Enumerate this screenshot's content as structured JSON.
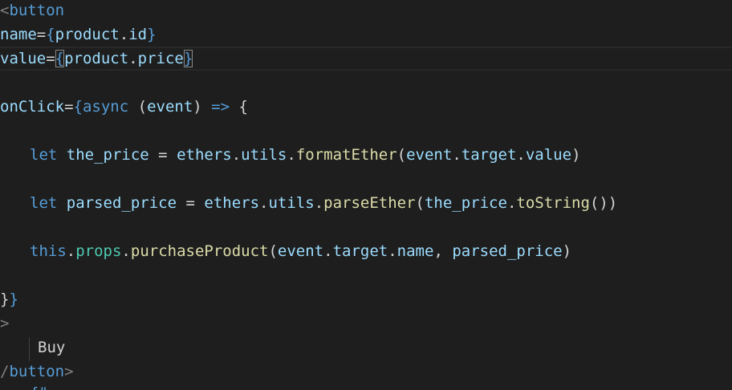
{
  "code": {
    "l1_open": "<",
    "l1_tag": "button",
    "l2_attr": "name",
    "l2_eq": "=",
    "l2_open": "{",
    "l2_obj": "product",
    "l2_dot": ".",
    "l2_prop": "id",
    "l2_close": "}",
    "l3_attr": "value",
    "l3_eq": "=",
    "l3_open": "{",
    "l3_obj": "product",
    "l3_dot": ".",
    "l3_prop": "price",
    "l3_close": "}",
    "l5_attr": "onClick",
    "l5_eq": "=",
    "l5_open": "{",
    "l5_async": "async",
    "l5_paren_open": " (",
    "l5_param": "event",
    "l5_paren_close": ") ",
    "l5_arrow": "=>",
    "l5_brace": " {",
    "l7_let": "let",
    "l7_var": "the_price",
    "l7_eq": " = ",
    "l7_obj": "ethers",
    "l7_dot1": ".",
    "l7_utils": "utils",
    "l7_dot2": ".",
    "l7_fn": "formatEther",
    "l7_p1": "(",
    "l7_event": "event",
    "l7_dot3": ".",
    "l7_target": "target",
    "l7_dot4": ".",
    "l7_value": "value",
    "l7_p2": ")",
    "l9_let": "let",
    "l9_var": "parsed_price",
    "l9_eq": " = ",
    "l9_obj": "ethers",
    "l9_dot1": ".",
    "l9_utils": "utils",
    "l9_dot2": ".",
    "l9_fn": "parseEther",
    "l9_p1": "(",
    "l9_arg": "the_price",
    "l9_dot3": ".",
    "l9_fn2": "toString",
    "l9_p2": "())",
    "l11_this": "this",
    "l11_dot1": ".",
    "l11_props": "props",
    "l11_dot2": ".",
    "l11_fn": "purchaseProduct",
    "l11_p1": "(",
    "l11_event": "event",
    "l11_dot3": ".",
    "l11_target": "target",
    "l11_dot4": ".",
    "l11_name": "name",
    "l11_comma": ", ",
    "l11_arg": "parsed_price",
    "l11_p2": ")",
    "l13_brace1": "}",
    "l13_brace2": "}",
    "l14_gt": ">",
    "l15_text": "Buy",
    "l16_open": "/",
    "l16_tag": "button",
    "l16_close": ">",
    "l17_partial": "{\"",
    "l17_rest": "  "
  },
  "colors": {
    "background": "#1e1e1e",
    "tag": "#569cd6",
    "attribute": "#9cdcfe",
    "function": "#dcdcaa",
    "property": "#4ec9b0",
    "punctuation": "#808080",
    "text": "#d4d4d4"
  }
}
